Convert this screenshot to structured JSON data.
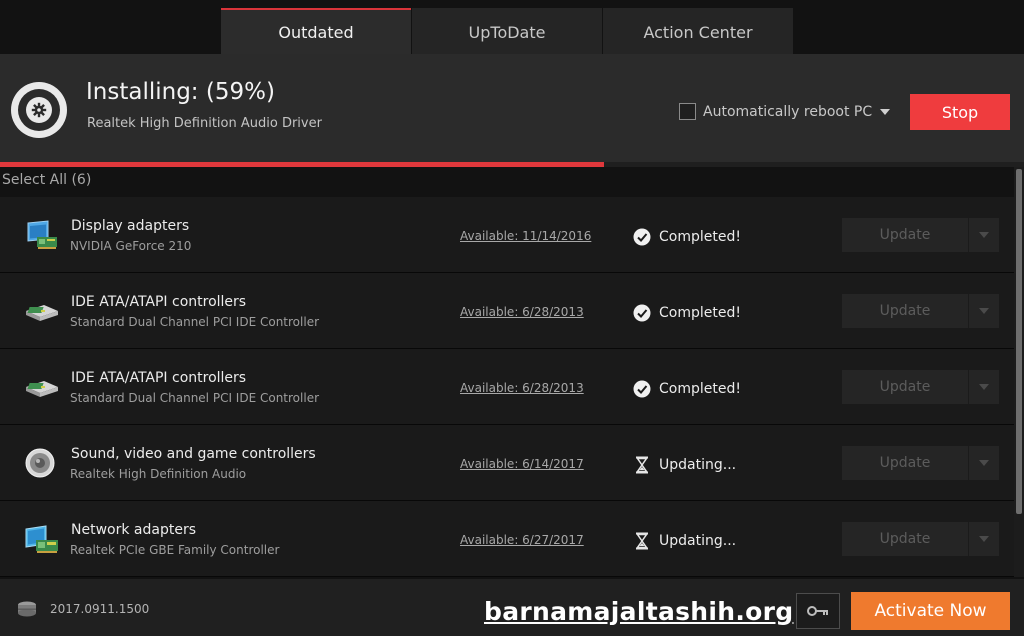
{
  "tabs": [
    {
      "label": "Outdated",
      "active": true
    },
    {
      "label": "UpToDate",
      "active": false
    },
    {
      "label": "Action Center",
      "active": false
    }
  ],
  "install": {
    "title": "Installing: (59%)",
    "progress_percent": 59,
    "driver_name": "Realtek High Definition Audio Driver",
    "reboot_label": "Automatically reboot PC",
    "reboot_checked": false,
    "stop_label": "Stop"
  },
  "list": {
    "select_all_label": "Select All (6)",
    "update_label": "Update",
    "items": [
      {
        "category": "Display adapters",
        "device": "NVIDIA GeForce 210",
        "available": "Available: 11/14/2016",
        "status": "Completed!",
        "status_icon": "check-circle-icon",
        "device_icon": "display-adapter-icon"
      },
      {
        "category": "IDE ATA/ATAPI controllers",
        "device": "Standard Dual Channel PCI IDE Controller",
        "available": "Available: 6/28/2013",
        "status": "Completed!",
        "status_icon": "check-circle-icon",
        "device_icon": "ide-controller-icon"
      },
      {
        "category": "IDE ATA/ATAPI controllers",
        "device": "Standard Dual Channel PCI IDE Controller",
        "available": "Available: 6/28/2013",
        "status": "Completed!",
        "status_icon": "check-circle-icon",
        "device_icon": "ide-controller-icon"
      },
      {
        "category": "Sound, video and game controllers",
        "device": "Realtek High Definition Audio",
        "available": "Available: 6/14/2017",
        "status": "Updating...",
        "status_icon": "hourglass-icon",
        "device_icon": "speaker-icon"
      },
      {
        "category": "Network adapters",
        "device": "Realtek PCIe GBE Family Controller",
        "available": "Available: 6/27/2017",
        "status": "Updating...",
        "status_icon": "hourglass-icon",
        "device_icon": "network-adapter-icon"
      }
    ]
  },
  "footer": {
    "version": "2017.0911.1500",
    "watermark": "barnamajaltashih.org",
    "activate_label": "Activate Now"
  },
  "colors": {
    "accent_red": "#ef3c3e",
    "progress_red": "#e0383c",
    "activate_orange": "#ef7a2e"
  }
}
